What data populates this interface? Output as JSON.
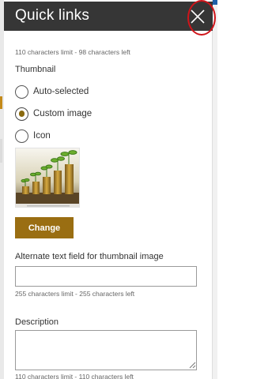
{
  "panel": {
    "title": "Quick links",
    "close_icon": "close-icon"
  },
  "title_hint": "110 characters limit - 98 characters left",
  "thumbnail": {
    "label": "Thumbnail",
    "options": [
      {
        "label": "Auto-selected",
        "checked": false
      },
      {
        "label": "Custom image",
        "checked": true
      },
      {
        "label": "Icon",
        "checked": false
      }
    ],
    "image_icon": "coins-plant-image",
    "change_label": "Change"
  },
  "alt_text": {
    "label": "Alternate text field for thumbnail image",
    "value": "",
    "hint": "255 characters limit - 255 characters left"
  },
  "description": {
    "label": "Description",
    "value": "",
    "hint": "110 characters limit - 110 characters left"
  },
  "colors": {
    "header_bg": "#363636",
    "accent": "#9a6e12",
    "annotation": "#d0141a"
  }
}
